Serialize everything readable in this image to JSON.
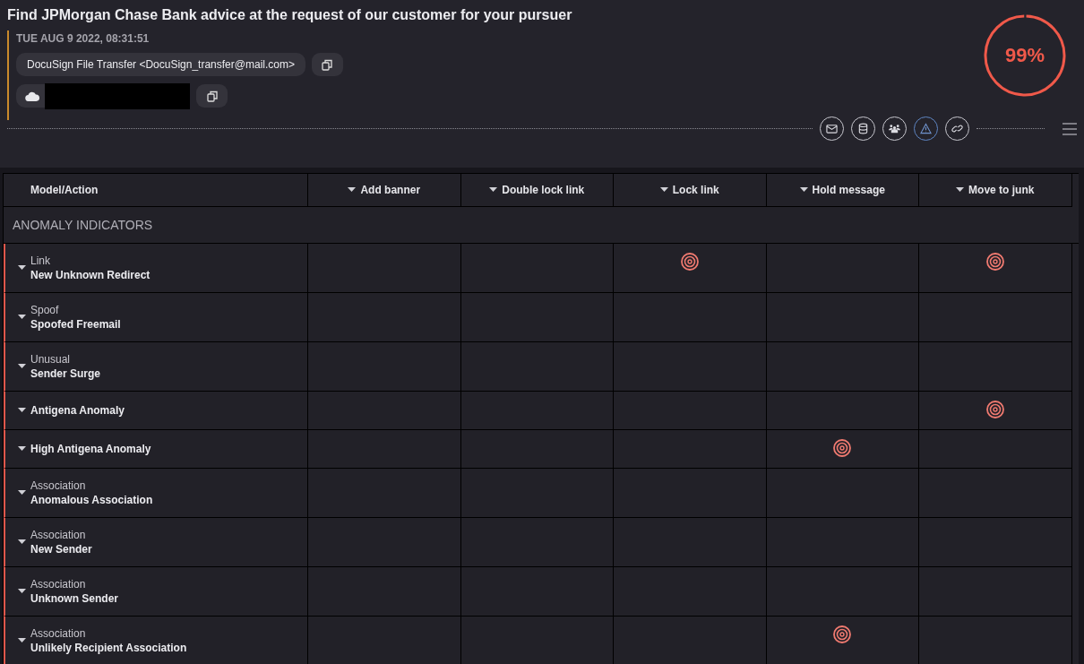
{
  "title": "Find JPMorgan Chase Bank advice at the request of our customer for your pursuer",
  "timestamp": "TUE AUG 9 2022, 08:31:51",
  "sender": "DocuSign File Transfer <DocuSign_transfer@mail.com>",
  "score": {
    "label": "99%",
    "level": 0.99
  },
  "tools": [
    {
      "kind": "mail",
      "selected": false
    },
    {
      "kind": "database",
      "selected": false
    },
    {
      "kind": "users",
      "selected": false
    },
    {
      "kind": "warning",
      "selected": true
    },
    {
      "kind": "link",
      "selected": false
    }
  ],
  "table": {
    "columns": [
      "Model/Action",
      "Add banner",
      "Double lock link",
      "Lock link",
      "Hold message",
      "Move to junk"
    ],
    "section": "ANOMALY INDICATORS",
    "rows": [
      {
        "category": "Link",
        "name": "New Unknown Redirect",
        "hits": [
          false,
          false,
          true,
          false,
          true
        ]
      },
      {
        "category": "Spoof",
        "name": "Spoofed Freemail",
        "hits": [
          false,
          false,
          false,
          false,
          false
        ]
      },
      {
        "category": "Unusual",
        "name": "Sender Surge",
        "hits": [
          false,
          false,
          false,
          false,
          false
        ]
      },
      {
        "name": "Antigena Anomaly",
        "hits": [
          false,
          false,
          false,
          false,
          true
        ]
      },
      {
        "name": "High Antigena Anomaly",
        "hits": [
          false,
          false,
          false,
          true,
          false
        ]
      },
      {
        "category": "Association",
        "name": "Anomalous Association",
        "hits": [
          false,
          false,
          false,
          false,
          false
        ]
      },
      {
        "category": "Association",
        "name": "New Sender",
        "hits": [
          false,
          false,
          false,
          false,
          false
        ]
      },
      {
        "category": "Association",
        "name": "Unknown Sender",
        "hits": [
          false,
          false,
          false,
          false,
          false
        ]
      },
      {
        "category": "Association",
        "name": "Unlikely Recipient Association",
        "hits": [
          false,
          false,
          false,
          true,
          false
        ]
      }
    ]
  }
}
